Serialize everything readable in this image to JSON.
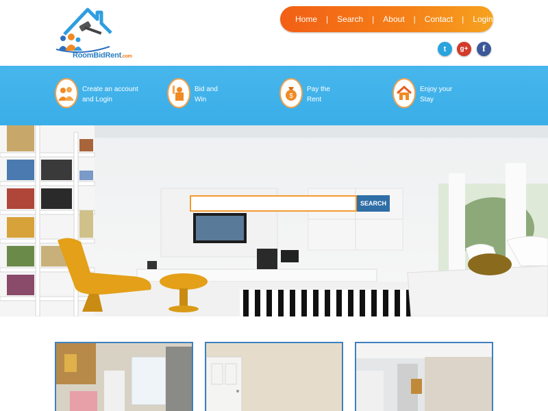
{
  "brand": {
    "name": "RoomBidRent",
    "tld": ".com"
  },
  "nav": {
    "items": [
      "Home",
      "Search",
      "About",
      "Contact",
      "Login"
    ],
    "separator": "|"
  },
  "social": {
    "twitter": "t",
    "google": "g+",
    "facebook": "f"
  },
  "steps": [
    {
      "line1": "Create an account",
      "line2": "and Login",
      "icon": "users-icon"
    },
    {
      "line1": "Bid and",
      "line2": "Win",
      "icon": "bidder-icon"
    },
    {
      "line1": "Pay the",
      "line2": "Rent",
      "icon": "money-bag-icon"
    },
    {
      "line1": "Enjoy your",
      "line2": "Stay",
      "icon": "house-icon"
    }
  ],
  "search": {
    "placeholder": "",
    "button_label": "SEARCH"
  },
  "colors": {
    "nav_start": "#f25f15",
    "nav_end": "#f6a21f",
    "band": "#3aaee8",
    "search_button": "#2f6ea6",
    "thumb_border": "#3c7fc0"
  }
}
